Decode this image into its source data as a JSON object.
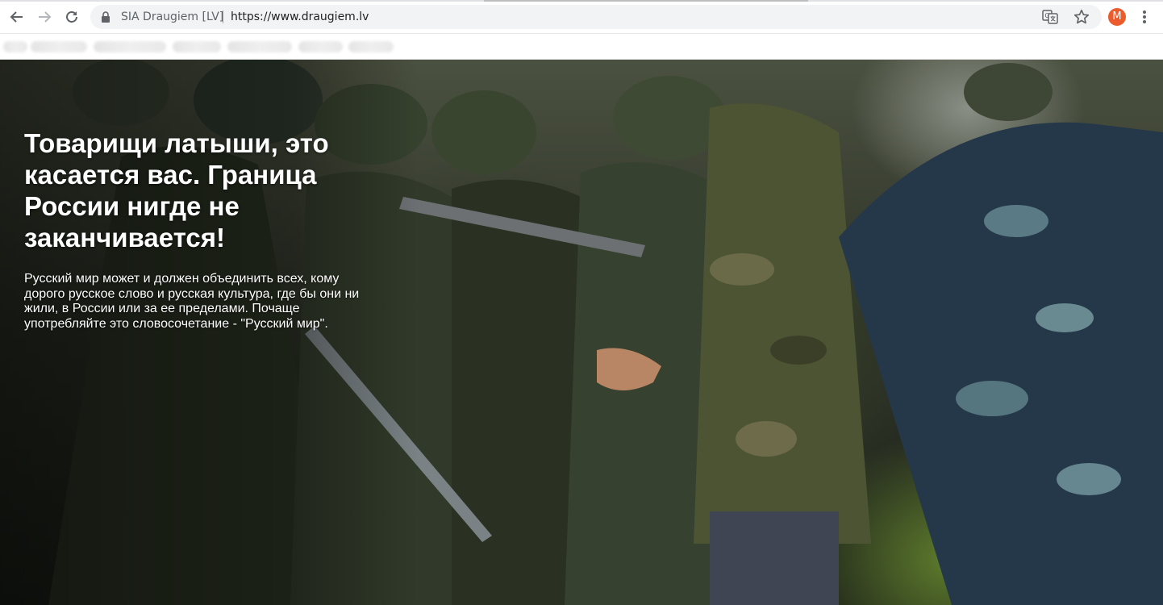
{
  "browser": {
    "site_identity": "SIA Draugiem [LV]",
    "url": "https://www.draugiem.lv",
    "profile_initial": "M",
    "accent": "#ec5b2b",
    "icons": [
      "back-icon",
      "forward-icon",
      "reload-icon",
      "lock-icon",
      "translate-icon",
      "star-icon",
      "menu-icon"
    ]
  },
  "page": {
    "headline": "Товарищи латыши, это касается вас. Граница России нигде не заканчивается!",
    "lead": "Русский мир может и должен объединить всех, кому дорого русское слово и русская культура, где бы они ни жили, в России или за ее пределами. Почаще употребляйте это словосочетание - \"Русский мир\"."
  }
}
